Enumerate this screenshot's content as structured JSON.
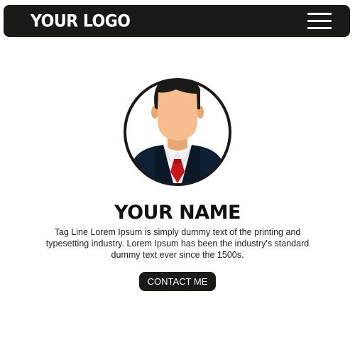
{
  "header": {
    "logo_text": "YOUR LOGO",
    "menu_icon": "hamburger-menu-icon"
  },
  "profile": {
    "avatar_icon": "person-avatar-icon",
    "name": "YOUR NAME",
    "tagline": "Tag Line Lorem Ipsum is simply dummy text of the printing and typesetting industry. Lorem Ipsum has been the industry's standard dummy text ever since the 1500s.",
    "contact_label": "CONTACT ME"
  },
  "colors": {
    "dark": "#1c1a17",
    "background": "#ffffff",
    "skin": "#f6bd8f",
    "hair": "#1a1a1a",
    "suit": "#0f2136",
    "tie": "#c8151b"
  }
}
